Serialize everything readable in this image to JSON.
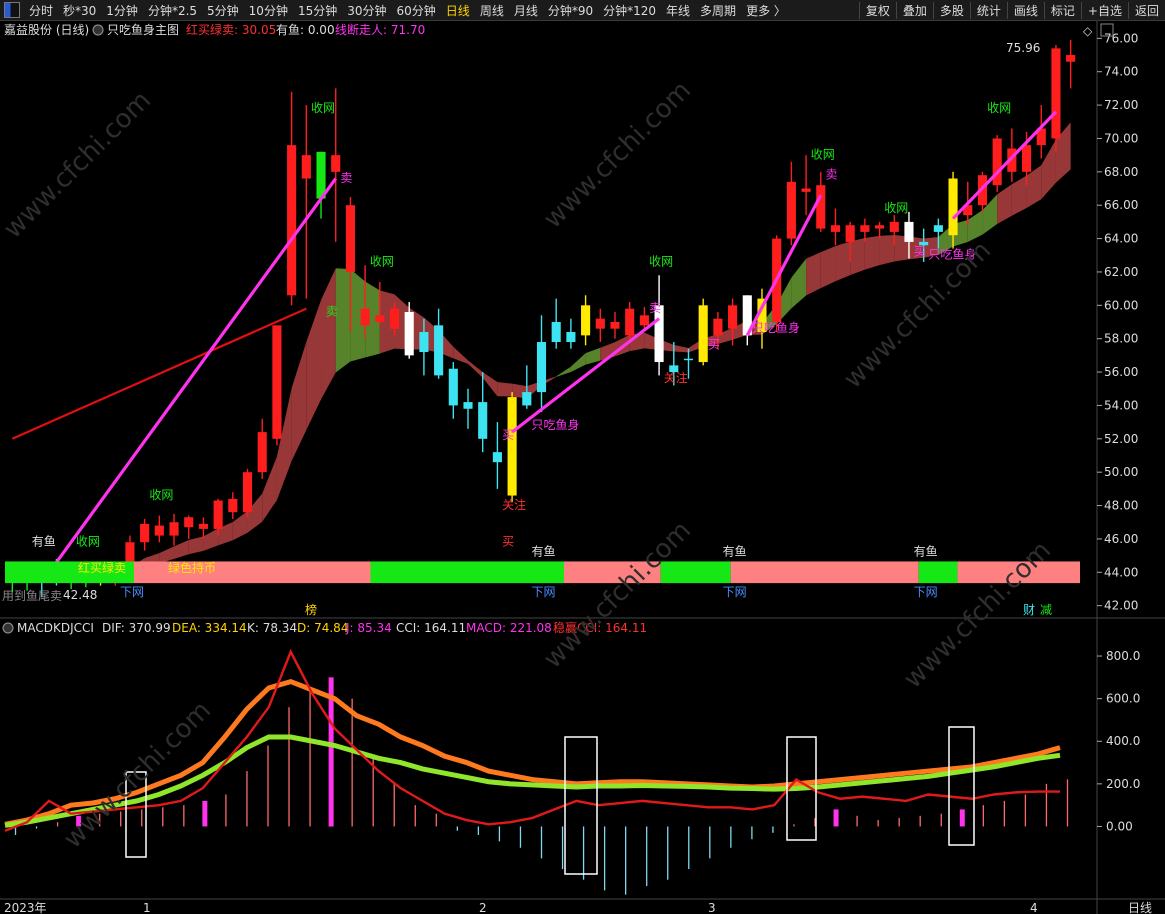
{
  "toolbar": {
    "periods": [
      "分时",
      "秒*30",
      "1分钟",
      "分钟*2.5",
      "5分钟",
      "10分钟",
      "15分钟",
      "30分钟",
      "60分钟",
      "日线",
      "周线",
      "月线",
      "分钟*90",
      "分钟*120",
      "年线",
      "多周期",
      "更多 〉"
    ],
    "active_period": "日线",
    "right_items": [
      "复权",
      "叠加",
      "多股",
      "统计",
      "画线",
      "标记",
      "+自选",
      "返回"
    ]
  },
  "main_header": {
    "stock": "嘉益股份 (日线)",
    "indicator": "只吃鱼身主图",
    "hongmai_label": "红买绿卖: 30.05",
    "youyu_label": "有鱼: 0.00",
    "xianduan_label": "线断走人: 71.70"
  },
  "sub_header": {
    "name": "MACDKDJCCI",
    "dif": "DIF: 370.99",
    "dea": "DEA: 334.14",
    "k": "K: 78.34",
    "d": "D: 74.84",
    "j": "J: 85.34",
    "cci": "CCI: 164.11",
    "macd": "MACD: 221.08",
    "wcci": "稳赢CCI: 164.11"
  },
  "colors": {
    "up": "#ff1e1e",
    "down_cyan": "#3de3f0",
    "yellow": "#ffea00",
    "white": "#ffffff",
    "green": "#16e816",
    "pink": "#ff8080",
    "magenta": "#ff33ee",
    "ribbon_red": "#a03a3a",
    "ribbon_green": "#5c8a2c"
  },
  "annotations": {
    "high_price": "75.96",
    "low_price": "42.48",
    "left_bottom_text": "用到鱼尾卖",
    "red_buy_text": "红买绿卖",
    "green_hold_text": "绿色持币",
    "bottom_mark": "榜",
    "right_marks": [
      "财",
      "减"
    ]
  },
  "chart_data": [
    {
      "type": "candlestick",
      "title": "只吃鱼身主图",
      "ylim": [
        41.5,
        76.8
      ],
      "y_ticks": [
        "42.00",
        "44.00",
        "46.00",
        "48.00",
        "50.00",
        "52.00",
        "54.00",
        "56.00",
        "58.00",
        "60.00",
        "62.00",
        "64.00",
        "66.00",
        "68.00",
        "70.00",
        "72.00",
        "74.00",
        "76.00"
      ],
      "candles": [
        {
          "o": 43.4,
          "h": 44.0,
          "l": 42.8,
          "c": 43.7,
          "t": "g"
        },
        {
          "o": 43.6,
          "h": 44.2,
          "l": 42.9,
          "c": 43.8,
          "t": "g"
        },
        {
          "o": 43.5,
          "h": 44.0,
          "l": 42.5,
          "c": 44.2,
          "t": "c"
        },
        {
          "o": 44.2,
          "h": 44.8,
          "l": 43.2,
          "c": 43.6,
          "t": "c"
        },
        {
          "o": 43.7,
          "h": 44.1,
          "l": 43.0,
          "c": 43.8,
          "t": "g"
        },
        {
          "o": 43.6,
          "h": 44.0,
          "l": 43.1,
          "c": 43.7,
          "t": "g"
        },
        {
          "o": 43.6,
          "h": 44.3,
          "l": 43.2,
          "c": 43.9,
          "t": "y"
        },
        {
          "o": 43.6,
          "h": 44.4,
          "l": 43.2,
          "c": 44.0,
          "t": "r"
        },
        {
          "o": 44.0,
          "h": 46.2,
          "l": 43.8,
          "c": 45.8,
          "t": "r"
        },
        {
          "o": 45.8,
          "h": 47.2,
          "l": 45.3,
          "c": 46.9,
          "t": "r"
        },
        {
          "o": 46.8,
          "h": 47.4,
          "l": 45.8,
          "c": 46.2,
          "t": "r"
        },
        {
          "o": 46.2,
          "h": 47.5,
          "l": 45.6,
          "c": 47.0,
          "t": "r"
        },
        {
          "o": 46.7,
          "h": 47.4,
          "l": 46.0,
          "c": 47.3,
          "t": "r"
        },
        {
          "o": 46.6,
          "h": 47.3,
          "l": 46.0,
          "c": 46.9,
          "t": "r"
        },
        {
          "o": 46.6,
          "h": 48.4,
          "l": 46.2,
          "c": 48.3,
          "t": "r"
        },
        {
          "o": 47.6,
          "h": 48.8,
          "l": 47.2,
          "c": 48.4,
          "t": "r"
        },
        {
          "o": 47.6,
          "h": 50.2,
          "l": 47.3,
          "c": 50.0,
          "t": "r"
        },
        {
          "o": 50.0,
          "h": 53.2,
          "l": 49.6,
          "c": 52.4,
          "t": "r"
        },
        {
          "o": 52.0,
          "h": 57.5,
          "l": 51.6,
          "c": 58.8,
          "t": "r"
        },
        {
          "o": 60.6,
          "h": 72.8,
          "l": 60.0,
          "c": 69.6,
          "t": "r"
        },
        {
          "o": 69.0,
          "h": 72.0,
          "l": 60.4,
          "c": 67.6,
          "t": "r"
        },
        {
          "o": 66.4,
          "h": 69.2,
          "l": 65.2,
          "c": 69.2,
          "t": "gb"
        },
        {
          "o": 68.0,
          "h": 73.0,
          "l": 63.8,
          "c": 69.0,
          "t": "r"
        },
        {
          "o": 66.0,
          "h": 66.5,
          "l": 58.4,
          "c": 62.0,
          "t": "r"
        },
        {
          "o": 59.8,
          "h": 62.4,
          "l": 58.0,
          "c": 58.8,
          "t": "r"
        },
        {
          "o": 59.4,
          "h": 61.4,
          "l": 58.8,
          "c": 59.0,
          "t": "r"
        },
        {
          "o": 58.6,
          "h": 60.2,
          "l": 58.2,
          "c": 59.8,
          "t": "r"
        },
        {
          "o": 59.6,
          "h": 60.2,
          "l": 56.8,
          "c": 57.0,
          "t": "w"
        },
        {
          "o": 58.4,
          "h": 59.2,
          "l": 55.8,
          "c": 57.2,
          "t": "c"
        },
        {
          "o": 58.8,
          "h": 59.8,
          "l": 55.6,
          "c": 55.8,
          "t": "c"
        },
        {
          "o": 56.2,
          "h": 56.6,
          "l": 53.2,
          "c": 54.0,
          "t": "c"
        },
        {
          "o": 54.2,
          "h": 55.0,
          "l": 52.6,
          "c": 53.8,
          "t": "c"
        },
        {
          "o": 54.2,
          "h": 56.0,
          "l": 51.2,
          "c": 52.0,
          "t": "c"
        },
        {
          "o": 51.2,
          "h": 53.0,
          "l": 49.0,
          "c": 50.6,
          "t": "c"
        },
        {
          "o": 48.6,
          "h": 54.8,
          "l": 48.2,
          "c": 54.5,
          "t": "y"
        },
        {
          "o": 54.8,
          "h": 56.4,
          "l": 53.8,
          "c": 54.0,
          "t": "c"
        },
        {
          "o": 54.8,
          "h": 59.4,
          "l": 53.6,
          "c": 57.8,
          "t": "c"
        },
        {
          "o": 59.0,
          "h": 60.4,
          "l": 57.4,
          "c": 57.8,
          "t": "c"
        },
        {
          "o": 57.8,
          "h": 59.2,
          "l": 57.4,
          "c": 58.4,
          "t": "c"
        },
        {
          "o": 58.2,
          "h": 60.6,
          "l": 57.6,
          "c": 60.0,
          "t": "y"
        },
        {
          "o": 59.2,
          "h": 59.8,
          "l": 57.8,
          "c": 58.6,
          "t": "r"
        },
        {
          "o": 58.6,
          "h": 59.6,
          "l": 58.0,
          "c": 59.0,
          "t": "r"
        },
        {
          "o": 58.2,
          "h": 60.2,
          "l": 57.8,
          "c": 59.8,
          "t": "r"
        },
        {
          "o": 59.4,
          "h": 59.9,
          "l": 58.6,
          "c": 58.8,
          "t": "r"
        },
        {
          "o": 60.0,
          "h": 61.8,
          "l": 55.8,
          "c": 56.6,
          "t": "w"
        },
        {
          "o": 56.0,
          "h": 57.8,
          "l": 55.2,
          "c": 56.4,
          "t": "c"
        },
        {
          "o": 56.8,
          "h": 57.4,
          "l": 55.6,
          "c": 56.8,
          "t": "c"
        },
        {
          "o": 56.6,
          "h": 60.4,
          "l": 56.4,
          "c": 60.0,
          "t": "y"
        },
        {
          "o": 58.2,
          "h": 59.6,
          "l": 57.4,
          "c": 59.2,
          "t": "r"
        },
        {
          "o": 58.6,
          "h": 60.4,
          "l": 57.6,
          "c": 60.0,
          "t": "r"
        },
        {
          "o": 58.2,
          "h": 60.6,
          "l": 57.6,
          "c": 60.6,
          "t": "w"
        },
        {
          "o": 60.4,
          "h": 61.0,
          "l": 57.4,
          "c": 58.4,
          "t": "y"
        },
        {
          "o": 59.0,
          "h": 64.2,
          "l": 58.4,
          "c": 64.0,
          "t": "r"
        },
        {
          "o": 64.0,
          "h": 68.6,
          "l": 63.6,
          "c": 67.4,
          "t": "r"
        },
        {
          "o": 67.0,
          "h": 69.0,
          "l": 65.4,
          "c": 66.8,
          "t": "r"
        },
        {
          "o": 67.2,
          "h": 68.0,
          "l": 64.4,
          "c": 64.6,
          "t": "r"
        },
        {
          "o": 64.4,
          "h": 65.8,
          "l": 63.6,
          "c": 64.8,
          "t": "r"
        },
        {
          "o": 63.8,
          "h": 65.0,
          "l": 62.6,
          "c": 64.8,
          "t": "r"
        },
        {
          "o": 64.4,
          "h": 65.2,
          "l": 63.8,
          "c": 64.8,
          "t": "r"
        },
        {
          "o": 64.8,
          "h": 65.0,
          "l": 64.0,
          "c": 64.6,
          "t": "r"
        },
        {
          "o": 65.0,
          "h": 65.4,
          "l": 63.6,
          "c": 64.4,
          "t": "r"
        },
        {
          "o": 65.0,
          "h": 65.6,
          "l": 62.8,
          "c": 63.8,
          "t": "w"
        },
        {
          "o": 63.8,
          "h": 64.6,
          "l": 62.6,
          "c": 63.6,
          "t": "c"
        },
        {
          "o": 64.8,
          "h": 65.2,
          "l": 63.4,
          "c": 64.4,
          "t": "c"
        },
        {
          "o": 64.2,
          "h": 68.0,
          "l": 63.4,
          "c": 67.6,
          "t": "y"
        },
        {
          "o": 65.4,
          "h": 67.4,
          "l": 64.8,
          "c": 66.0,
          "t": "r"
        },
        {
          "o": 66.0,
          "h": 68.0,
          "l": 65.6,
          "c": 67.8,
          "t": "r"
        },
        {
          "o": 67.2,
          "h": 70.2,
          "l": 66.8,
          "c": 70.0,
          "t": "r"
        },
        {
          "o": 68.0,
          "h": 70.6,
          "l": 67.4,
          "c": 69.4,
          "t": "r"
        },
        {
          "o": 68.0,
          "h": 70.4,
          "l": 67.2,
          "c": 69.6,
          "t": "r"
        },
        {
          "o": 69.6,
          "h": 72.0,
          "l": 68.8,
          "c": 70.6,
          "t": "r"
        },
        {
          "o": 70.0,
          "h": 75.6,
          "l": 69.2,
          "c": 75.4,
          "t": "r"
        },
        {
          "o": 75.0,
          "h": 75.9,
          "l": 73.0,
          "c": 74.6,
          "t": "r"
        }
      ],
      "ma_line_start": 52.0,
      "ma_line_end": 59.8,
      "labels": {
        "shouwang": "收网",
        "mai": "卖",
        "mai_buy": "买",
        "guanzhu": "关注",
        "zhichiyushen": "只吃鱼身",
        "youyu": "有鱼",
        "xiawang": "下网"
      },
      "band": [
        {
          "from": 0,
          "to": 0.12,
          "color": "green"
        },
        {
          "from": 0.12,
          "to": 0.34,
          "color": "pink"
        },
        {
          "from": 0.34,
          "to": 0.52,
          "color": "green"
        },
        {
          "from": 0.52,
          "to": 0.61,
          "color": "pink"
        },
        {
          "from": 0.61,
          "to": 0.675,
          "color": "green"
        },
        {
          "from": 0.675,
          "to": 0.85,
          "color": "pink"
        },
        {
          "from": 0.85,
          "to": 0.886,
          "color": "green"
        },
        {
          "from": 0.886,
          "to": 1,
          "color": "pink"
        }
      ],
      "x_labels": [
        "2023年",
        "1",
        "2",
        "3",
        "4"
      ],
      "period_label": "日线"
    },
    {
      "type": "line",
      "title": "MACDKDJCCI",
      "ylim": [
        -350,
        880
      ],
      "y_ticks": [
        "0.00",
        "200.0",
        "400.0",
        "600.0",
        "800.0"
      ],
      "series": [
        {
          "name": "DIF",
          "values": [
            10,
            30,
            60,
            100,
            110,
            130,
            160,
            200,
            240,
            300,
            420,
            550,
            650,
            680,
            640,
            600,
            520,
            480,
            420,
            380,
            330,
            300,
            260,
            240,
            220,
            210,
            200,
            205,
            210,
            210,
            205,
            200,
            195,
            190,
            185,
            190,
            200,
            210,
            220,
            230,
            240,
            250,
            260,
            270,
            280,
            300,
            320,
            340,
            370
          ]
        },
        {
          "name": "DEA",
          "values": [
            5,
            20,
            40,
            60,
            80,
            100,
            120,
            150,
            190,
            240,
            300,
            370,
            420,
            420,
            400,
            380,
            350,
            320,
            300,
            270,
            250,
            230,
            210,
            200,
            195,
            190,
            185,
            190,
            190,
            192,
            190,
            188,
            185,
            180,
            178,
            175,
            178,
            185,
            195,
            205,
            215,
            225,
            235,
            250,
            265,
            280,
            300,
            320,
            334
          ]
        },
        {
          "name": "CCI",
          "values": [
            -20,
            20,
            120,
            60,
            70,
            80,
            90,
            100,
            120,
            180,
            300,
            420,
            560,
            820,
            620,
            460,
            360,
            260,
            180,
            120,
            60,
            30,
            10,
            20,
            40,
            80,
            120,
            100,
            110,
            120,
            110,
            100,
            90,
            90,
            80,
            100,
            220,
            160,
            130,
            140,
            130,
            120,
            150,
            140,
            130,
            150,
            160,
            164,
            164
          ]
        }
      ],
      "histogram": [
        -40,
        -10,
        20,
        50,
        60,
        70,
        80,
        90,
        100,
        120,
        150,
        260,
        380,
        560,
        650,
        700,
        600,
        320,
        200,
        100,
        60,
        -20,
        -40,
        -70,
        -100,
        -150,
        -200,
        -250,
        -300,
        -320,
        -280,
        -250,
        -200,
        -150,
        -100,
        -60,
        -30,
        10,
        40,
        80,
        50,
        30,
        40,
        50,
        60,
        80,
        100,
        120,
        150,
        200,
        221
      ]
    }
  ]
}
